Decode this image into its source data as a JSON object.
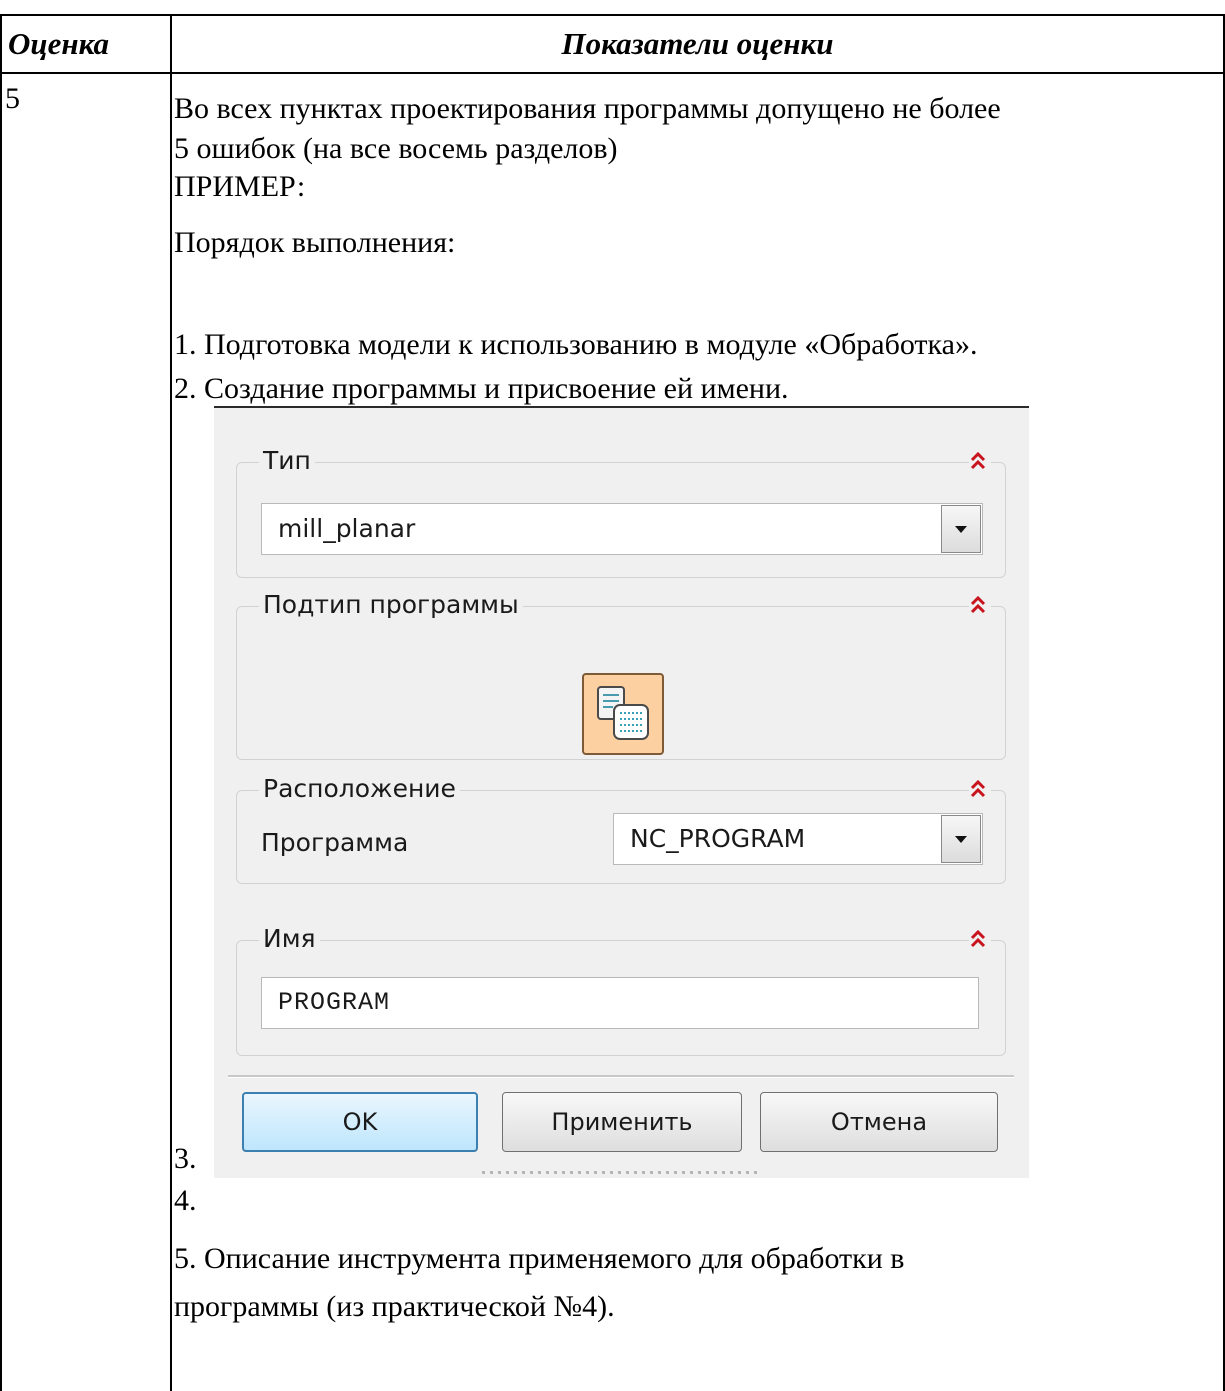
{
  "table": {
    "header": {
      "grade": "Оценка",
      "criteria": "Показатели оценки"
    },
    "row": {
      "grade": "5"
    }
  },
  "content": {
    "intro_line1": "Во всех пунктах проектирования программы допущено не более",
    "intro_line2": "5 ошибок (на все восемь разделов)",
    "example": "ПРИМЕР:",
    "order": "Порядок выполнения:",
    "step1": "1. Подготовка модели к использованию в модуле «Обработка».",
    "step2": "2. Создание программы и присвоение ей имени.",
    "step3": "3.",
    "step4": "4.",
    "step5_line1": "5. Описание инструмента применяемого для обработки в",
    "step5_line2": "программы (из практической №4)."
  },
  "dialog": {
    "type_group": {
      "title": "Тип",
      "value": "mill_planar"
    },
    "subtype_group": {
      "title": "Подтип программы"
    },
    "location_group": {
      "title": "Расположение",
      "program_label": "Программа",
      "program_value": "NC_PROGRAM"
    },
    "name_group": {
      "title": "Имя",
      "value": "PROGRAM"
    },
    "buttons": {
      "ok": "OK",
      "apply": "Применить",
      "cancel": "Отмена"
    },
    "colors": {
      "collapse_icon": "#c8141e",
      "subtype_button_fill": "#fdd0a2",
      "ok_button_border": "#3c7fb1"
    },
    "icons": {
      "collapse": "double-chevron-up-icon",
      "subtype": "program-subtype-icon",
      "dropdown": "dropdown-arrow-icon"
    }
  }
}
